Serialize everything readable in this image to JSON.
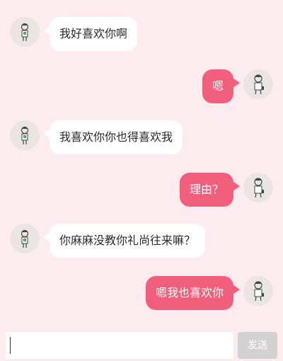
{
  "messages": [
    {
      "side": "in",
      "text": "我好喜欢你啊"
    },
    {
      "side": "out",
      "text": "嗯"
    },
    {
      "side": "in",
      "text": "我喜欢你你也得喜欢我"
    },
    {
      "side": "out",
      "text": "理由？"
    },
    {
      "side": "in",
      "text": "你麻麻没教你礼尚往来嘛？"
    },
    {
      "side": "out",
      "text": "嗯我也喜欢你"
    }
  ],
  "input": {
    "value": "",
    "placeholder": ""
  },
  "send_label": "发送",
  "colors": {
    "background": "#fcecef",
    "incoming_bubble": "#ffffff",
    "outgoing_bubble": "#f25f7d",
    "send_button": "#d4d1d2"
  },
  "icons": {
    "avatar": "cartoon-person-avatar-icon"
  }
}
